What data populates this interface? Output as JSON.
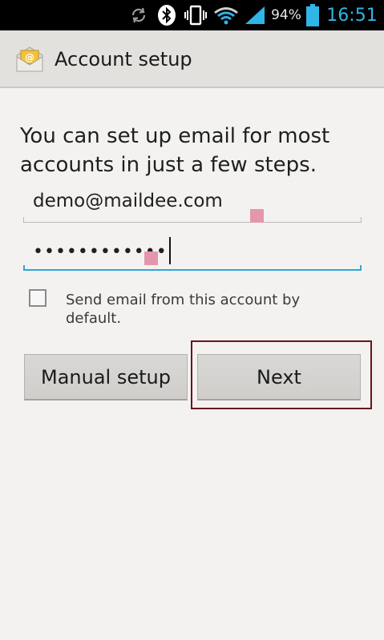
{
  "status_bar": {
    "battery_percent": "94%",
    "time": "16:51",
    "icons": [
      "sync-icon",
      "bluetooth-icon",
      "vibrate-icon",
      "wifi-icon",
      "signal-icon",
      "battery-icon"
    ]
  },
  "action_bar": {
    "title": "Account setup",
    "icon": "email-app-icon"
  },
  "form": {
    "intro": "You can set up email for most accounts in just a few steps.",
    "email_value": "demo@maildee.com",
    "password_value": "••••••••••••",
    "checkbox_label": "Send email from this account by default.",
    "checkbox_checked": false
  },
  "buttons": {
    "manual_setup": "Manual setup",
    "next": "Next"
  },
  "colors": {
    "accent": "#33a6d4",
    "clock": "#2fb5e6",
    "highlight": "#6d1414",
    "touch_marker": "#e497ab"
  }
}
